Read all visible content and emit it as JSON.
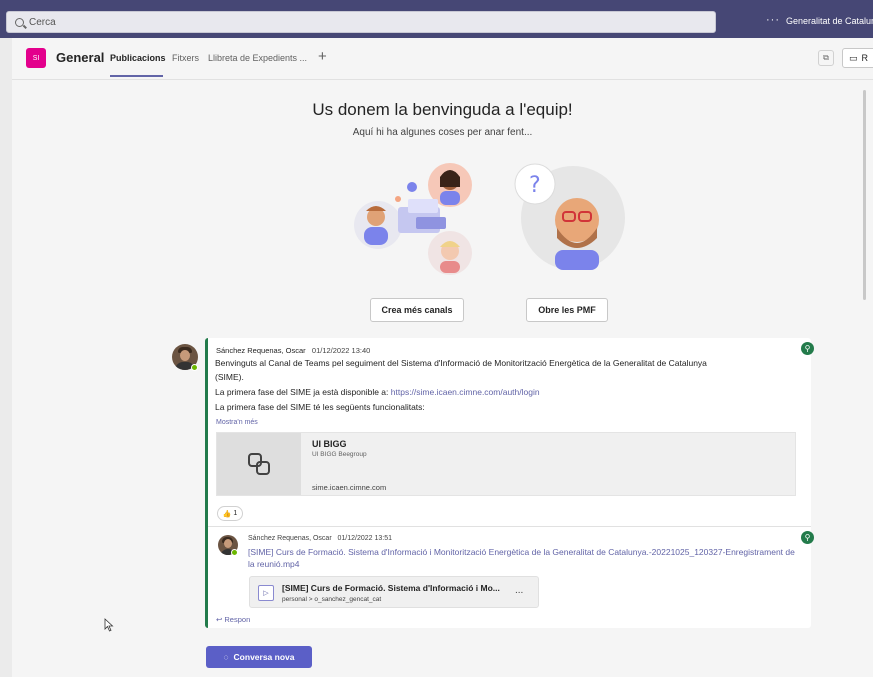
{
  "topbar": {
    "search_placeholder": "Cerca",
    "more": "···",
    "org_name": "Generalitat de Catalunya"
  },
  "channel": {
    "team_initials": "SI",
    "name": "General",
    "tabs": [
      {
        "label": "Publicacions",
        "active": true
      },
      {
        "label": "Fitxers",
        "active": false
      },
      {
        "label": "Llibreta de Expedients ...",
        "active": false
      }
    ],
    "add_tab": "+",
    "meet_label": "R"
  },
  "welcome": {
    "title": "Us donem la benvinguda a l'equip!",
    "subtitle": "Aquí hi ha algunes coses per anar fent...",
    "buttons": [
      "Crea més canals",
      "Obre les PMF"
    ]
  },
  "post": {
    "author": "Sánchez Requenas, Oscar",
    "timestamp": "01/12/2022 13:40",
    "line1": "Benvinguts al Canal de Teams pel seguiment del Sistema d'Informació de Monitorització Energètica de la Generalitat de Catalunya",
    "line1b": "(SIME).",
    "line2_prefix": "La primera fase del SIME ja està disponible a: ",
    "line2_link": "https://sime.icaen.cimne.com/auth/login",
    "line3": "La primera fase del SIME té les següents funcionalitats:",
    "show_more": "Mostra'n més",
    "link_card": {
      "title": "UI BIGG",
      "subtitle": "UI BIGG Beegroup",
      "url": "sime.icaen.cimne.com"
    },
    "reaction": {
      "emoji": "👍",
      "count": "1"
    }
  },
  "reply": {
    "author": "Sánchez Requenas, Oscar",
    "timestamp": "01/12/2022 13:51",
    "text": "[SIME] Curs de Formació. Sistema d'Informació i Monitorització Energètica de la Generalitat de Catalunya.-20221025_120327-Enregistrament de la reunió.mp4",
    "file": {
      "title": "[SIME] Curs de Formació. Sistema d'Informació i Mo...",
      "location": "personal > o_sanchez_gencat_cat",
      "menu": "..."
    }
  },
  "respon_label": "Respon",
  "new_conversation": "Conversa nova"
}
